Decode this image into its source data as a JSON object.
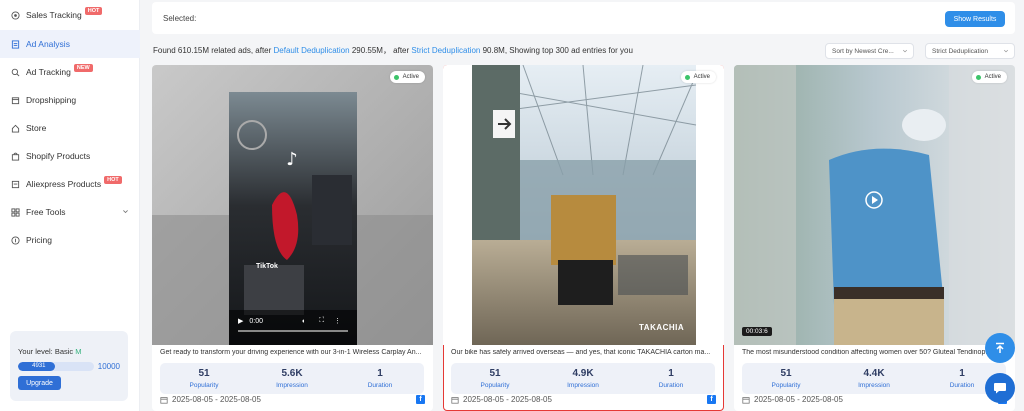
{
  "sidebar": {
    "items": [
      {
        "label": "Sales Tracking",
        "tag": "HOT",
        "icon": "target-icon"
      },
      {
        "label": "Ad Analysis",
        "icon": "document-icon",
        "active": true
      },
      {
        "label": "Ad Tracking",
        "tag": "NEW",
        "icon": "search-icon"
      },
      {
        "label": "Dropshipping",
        "icon": "box-icon"
      },
      {
        "label": "Store",
        "icon": "home-icon"
      },
      {
        "label": "Shopify Products",
        "icon": "bag-icon"
      },
      {
        "label": "Aliexpress Products",
        "tag": "HOT",
        "icon": "cart-icon"
      },
      {
        "label": "Free Tools",
        "icon": "grid-icon"
      },
      {
        "label": "Pricing",
        "icon": "coin-icon"
      }
    ],
    "level": {
      "label": "Your level: Basic",
      "badge": "M",
      "current": "4931",
      "max": "10000",
      "progress": 0.4931,
      "upgrade": "Upgrade"
    }
  },
  "header": {
    "selected_label": "Selected:",
    "show_results": "Show Results"
  },
  "summary": {
    "part1": "Found 610.15M related ads, after",
    "link1": "Default Deduplication",
    "part2": "290.55M， after",
    "link2": "Strict Deduplication",
    "part3": "90.8M, Showing top 300 ad entries for you"
  },
  "filters": {
    "sort": "Sort by Newest Cre...",
    "dedup": "Strict Deduplication"
  },
  "cards": [
    {
      "status": "Active",
      "desc": "Get ready to transform your driving experience with our 3-in-1 Wireless Carplay An...",
      "popularity": "51",
      "impression": "5.6K",
      "duration": "1",
      "dates": "2025-08-05 - 2025-08-05",
      "video_time": "0:00",
      "watermark": "TikTok"
    },
    {
      "status": "Active",
      "desc": "Our bike has safely arrived overseas — and yes, that iconic TAKACHIA carton ma...",
      "popularity": "51",
      "impression": "4.9K",
      "duration": "1",
      "dates": "2025-08-05 - 2025-08-05",
      "brand": "TAKACHIA"
    },
    {
      "status": "Active",
      "desc": "The most misunderstood condition affecting women over 50? Gluteal Tendinop...",
      "popularity": "51",
      "impression": "4.4K",
      "duration": "1",
      "dates": "2025-08-05 - 2025-08-05",
      "video_length": "00:03:6"
    }
  ],
  "labels": {
    "popularity": "Popularity",
    "impression": "Impression",
    "duration": "Duration"
  },
  "colors": {
    "accent": "#2f8ee8",
    "active_dot": "#3cc46a",
    "hot": "#f06a6a",
    "highlight": "#e53935"
  }
}
